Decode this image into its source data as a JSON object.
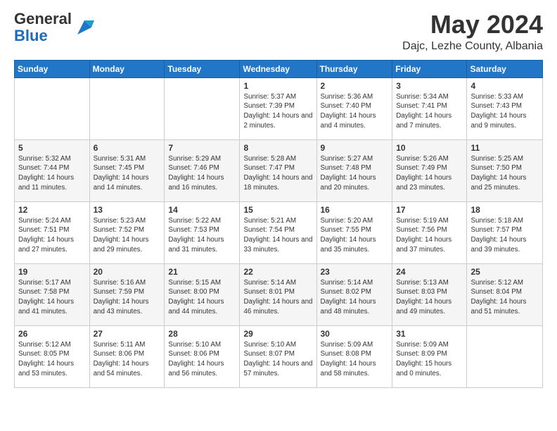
{
  "logo": {
    "general": "General",
    "blue": "Blue"
  },
  "title": "May 2024",
  "location": "Dajc, Lezhe County, Albania",
  "days_of_week": [
    "Sunday",
    "Monday",
    "Tuesday",
    "Wednesday",
    "Thursday",
    "Friday",
    "Saturday"
  ],
  "weeks": [
    [
      null,
      null,
      null,
      {
        "day": 1,
        "sunrise": "5:37 AM",
        "sunset": "7:39 PM",
        "daylight": "14 hours and 2 minutes."
      },
      {
        "day": 2,
        "sunrise": "5:36 AM",
        "sunset": "7:40 PM",
        "daylight": "14 hours and 4 minutes."
      },
      {
        "day": 3,
        "sunrise": "5:34 AM",
        "sunset": "7:41 PM",
        "daylight": "14 hours and 7 minutes."
      },
      {
        "day": 4,
        "sunrise": "5:33 AM",
        "sunset": "7:43 PM",
        "daylight": "14 hours and 9 minutes."
      }
    ],
    [
      {
        "day": 5,
        "sunrise": "5:32 AM",
        "sunset": "7:44 PM",
        "daylight": "14 hours and 11 minutes."
      },
      {
        "day": 6,
        "sunrise": "5:31 AM",
        "sunset": "7:45 PM",
        "daylight": "14 hours and 14 minutes."
      },
      {
        "day": 7,
        "sunrise": "5:29 AM",
        "sunset": "7:46 PM",
        "daylight": "14 hours and 16 minutes."
      },
      {
        "day": 8,
        "sunrise": "5:28 AM",
        "sunset": "7:47 PM",
        "daylight": "14 hours and 18 minutes."
      },
      {
        "day": 9,
        "sunrise": "5:27 AM",
        "sunset": "7:48 PM",
        "daylight": "14 hours and 20 minutes."
      },
      {
        "day": 10,
        "sunrise": "5:26 AM",
        "sunset": "7:49 PM",
        "daylight": "14 hours and 23 minutes."
      },
      {
        "day": 11,
        "sunrise": "5:25 AM",
        "sunset": "7:50 PM",
        "daylight": "14 hours and 25 minutes."
      }
    ],
    [
      {
        "day": 12,
        "sunrise": "5:24 AM",
        "sunset": "7:51 PM",
        "daylight": "14 hours and 27 minutes."
      },
      {
        "day": 13,
        "sunrise": "5:23 AM",
        "sunset": "7:52 PM",
        "daylight": "14 hours and 29 minutes."
      },
      {
        "day": 14,
        "sunrise": "5:22 AM",
        "sunset": "7:53 PM",
        "daylight": "14 hours and 31 minutes."
      },
      {
        "day": 15,
        "sunrise": "5:21 AM",
        "sunset": "7:54 PM",
        "daylight": "14 hours and 33 minutes."
      },
      {
        "day": 16,
        "sunrise": "5:20 AM",
        "sunset": "7:55 PM",
        "daylight": "14 hours and 35 minutes."
      },
      {
        "day": 17,
        "sunrise": "5:19 AM",
        "sunset": "7:56 PM",
        "daylight": "14 hours and 37 minutes."
      },
      {
        "day": 18,
        "sunrise": "5:18 AM",
        "sunset": "7:57 PM",
        "daylight": "14 hours and 39 minutes."
      }
    ],
    [
      {
        "day": 19,
        "sunrise": "5:17 AM",
        "sunset": "7:58 PM",
        "daylight": "14 hours and 41 minutes."
      },
      {
        "day": 20,
        "sunrise": "5:16 AM",
        "sunset": "7:59 PM",
        "daylight": "14 hours and 43 minutes."
      },
      {
        "day": 21,
        "sunrise": "5:15 AM",
        "sunset": "8:00 PM",
        "daylight": "14 hours and 44 minutes."
      },
      {
        "day": 22,
        "sunrise": "5:14 AM",
        "sunset": "8:01 PM",
        "daylight": "14 hours and 46 minutes."
      },
      {
        "day": 23,
        "sunrise": "5:14 AM",
        "sunset": "8:02 PM",
        "daylight": "14 hours and 48 minutes."
      },
      {
        "day": 24,
        "sunrise": "5:13 AM",
        "sunset": "8:03 PM",
        "daylight": "14 hours and 49 minutes."
      },
      {
        "day": 25,
        "sunrise": "5:12 AM",
        "sunset": "8:04 PM",
        "daylight": "14 hours and 51 minutes."
      }
    ],
    [
      {
        "day": 26,
        "sunrise": "5:12 AM",
        "sunset": "8:05 PM",
        "daylight": "14 hours and 53 minutes."
      },
      {
        "day": 27,
        "sunrise": "5:11 AM",
        "sunset": "8:06 PM",
        "daylight": "14 hours and 54 minutes."
      },
      {
        "day": 28,
        "sunrise": "5:10 AM",
        "sunset": "8:06 PM",
        "daylight": "14 hours and 56 minutes."
      },
      {
        "day": 29,
        "sunrise": "5:10 AM",
        "sunset": "8:07 PM",
        "daylight": "14 hours and 57 minutes."
      },
      {
        "day": 30,
        "sunrise": "5:09 AM",
        "sunset": "8:08 PM",
        "daylight": "14 hours and 58 minutes."
      },
      {
        "day": 31,
        "sunrise": "5:09 AM",
        "sunset": "8:09 PM",
        "daylight": "15 hours and 0 minutes."
      },
      null
    ]
  ]
}
